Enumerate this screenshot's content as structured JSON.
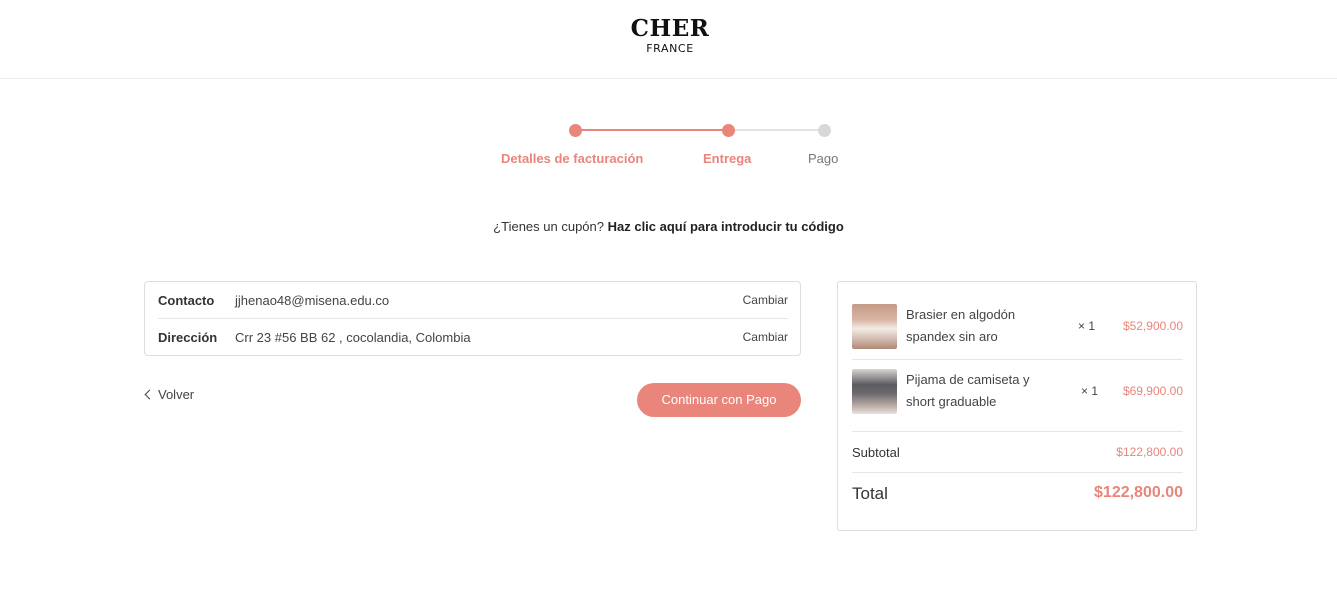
{
  "brand": {
    "name": "CHER",
    "subtitle": "FRANCE"
  },
  "colors": {
    "accent": "#e9857a",
    "inactive": "#d8d8d8",
    "text": "#333333",
    "border": "#dddddd"
  },
  "steps": [
    {
      "label": "Detalles de facturación",
      "state": "completed"
    },
    {
      "label": "Entrega",
      "state": "current"
    },
    {
      "label": "Pago",
      "state": "pending"
    }
  ],
  "coupon": {
    "prompt": "¿Tienes un cupón?",
    "link": "Haz clic aquí para introducir tu código"
  },
  "review": {
    "rows": [
      {
        "label": "Contacto",
        "value": "jjhenao48@misena.edu.co",
        "action": "Cambiar"
      },
      {
        "label": "Dirección",
        "value": "Crr 23 #56 BB 62 , cocolandia, Colombia",
        "action": "Cambiar"
      }
    ]
  },
  "actions": {
    "back": "Volver",
    "continue": "Continuar con Pago"
  },
  "summary": {
    "items": [
      {
        "name": "Brasier en algodón spandex sin aro",
        "qty": "× 1",
        "price": "$52,900.00"
      },
      {
        "name": "Pijama de camiseta y short graduable",
        "qty": "× 1",
        "price": "$69,900.00"
      }
    ],
    "subtotal_label": "Subtotal",
    "subtotal_value": "$122,800.00",
    "total_label": "Total",
    "total_value": "$122,800.00"
  }
}
